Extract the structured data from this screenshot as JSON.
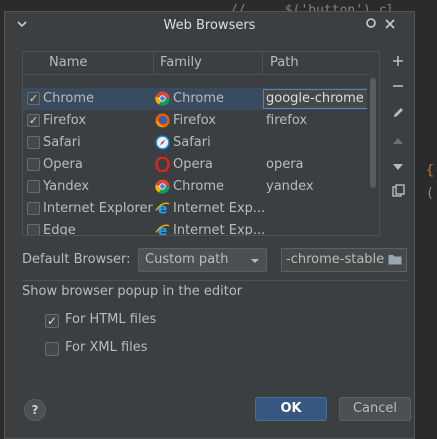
{
  "background_code": {
    "line1": "//     $('button').cl",
    "brace": "{",
    "paren": "("
  },
  "dialog": {
    "title": "Web Browsers",
    "icons": [
      "chevron-down-icon",
      "options-icon",
      "close-icon"
    ]
  },
  "table": {
    "columns": [
      "Name",
      "Family",
      "Path"
    ],
    "rows": [
      {
        "checked": true,
        "name": "Chrome",
        "family": "Chrome",
        "family_icon": "chrome-icon",
        "path": "google-chrome",
        "selected": true
      },
      {
        "checked": true,
        "name": "Firefox",
        "family": "Firefox",
        "family_icon": "firefox-icon",
        "path": "firefox",
        "selected": false
      },
      {
        "checked": false,
        "name": "Safari",
        "family": "Safari",
        "family_icon": "safari-icon",
        "path": "",
        "selected": false
      },
      {
        "checked": false,
        "name": "Opera",
        "family": "Opera",
        "family_icon": "opera-icon",
        "path": "opera",
        "selected": false
      },
      {
        "checked": false,
        "name": "Yandex",
        "family": "Chrome",
        "family_icon": "chrome-icon",
        "path": "yandex",
        "selected": false
      },
      {
        "checked": false,
        "name": "Internet Explorer",
        "family": "Internet Exp...",
        "family_icon": "ie-icon",
        "path": "",
        "selected": false
      },
      {
        "checked": false,
        "name": "Edge",
        "family": "Internet Exp...",
        "family_icon": "ie-icon",
        "path": "",
        "selected": false
      }
    ],
    "side_buttons": [
      "add-icon",
      "remove-icon",
      "edit-icon",
      "move-up-icon",
      "move-down-icon",
      "copy-icon"
    ]
  },
  "default_browser": {
    "label": "Default Browser:",
    "selected": "Custom path",
    "path_value": "-chrome-stable"
  },
  "popup": {
    "label": "Show browser popup in the editor",
    "html_label": "For HTML files",
    "html_checked": true,
    "xml_label": "For XML files",
    "xml_checked": false
  },
  "buttons": {
    "help": "?",
    "ok": "OK",
    "cancel": "Cancel"
  },
  "colors": {
    "background": "#2b2b2b",
    "dialog": "#3c3f41",
    "accent": "#365880",
    "selection": "#394b5e",
    "edit_border": "#4a88c7"
  }
}
